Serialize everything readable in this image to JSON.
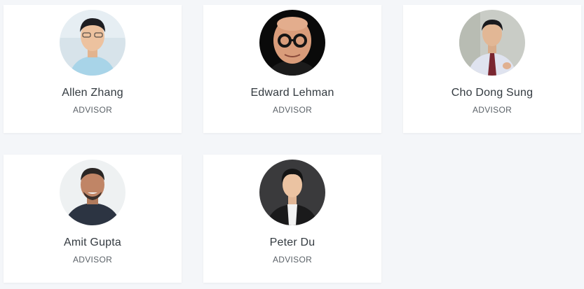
{
  "team": [
    {
      "name": "Allen Zhang",
      "role": "ADVISOR"
    },
    {
      "name": "Edward Lehman",
      "role": "ADVISOR"
    },
    {
      "name": "Cho Dong Sung",
      "role": "ADVISOR"
    },
    {
      "name": "Amit Gupta",
      "role": "ADVISOR"
    },
    {
      "name": "Peter Du",
      "role": "ADVISOR"
    }
  ],
  "colors": {
    "page_background": "#f4f6f9",
    "card_background": "#ffffff",
    "name_text": "#333a40",
    "role_text": "#5b6268"
  }
}
